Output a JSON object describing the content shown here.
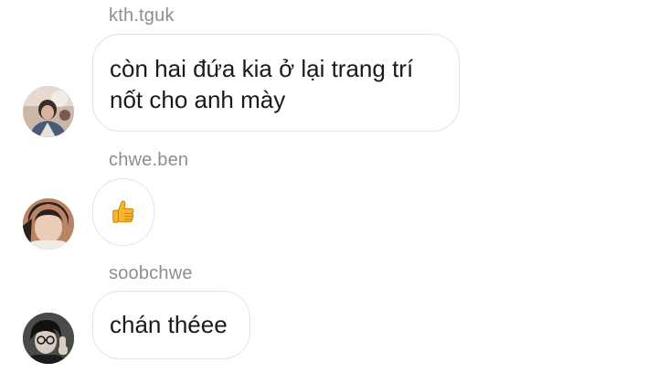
{
  "messages": [
    {
      "username": "kth.tguk",
      "text": "còn hai đứa kia ở lại trang trí\nnốt cho anh mày",
      "avatar": "user-avatar-photo"
    },
    {
      "username": "chwe.ben",
      "emoji": "thumbs-up-icon",
      "avatar": "user-avatar-photo"
    },
    {
      "username": "soobchwe",
      "text": "chán théee",
      "avatar": "user-avatar-photo"
    }
  ],
  "colors": {
    "username": "#8e8e8e",
    "bubble_border": "#e3e3e3",
    "text": "#1a1a1a",
    "thumb": "#f5b62c"
  }
}
